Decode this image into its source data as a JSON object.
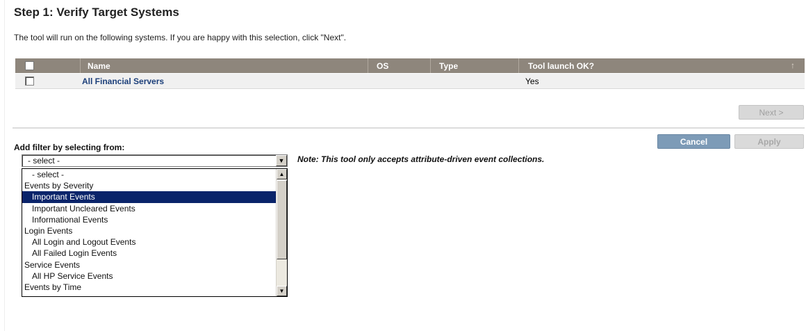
{
  "page": {
    "title": "Step 1: Verify Target Systems",
    "intro": "The tool will run on the following systems. If you are happy with this selection, click \"Next\"."
  },
  "grid": {
    "columns": [
      "Name",
      "OS",
      "Type",
      "Tool launch OK?"
    ],
    "sort_glyph": "↑",
    "rows": [
      {
        "name": "All Financial Servers",
        "os": "",
        "type": "",
        "launch_ok": "Yes"
      }
    ]
  },
  "buttons": {
    "next": "Next >",
    "cancel": "Cancel",
    "apply": "Apply"
  },
  "filter": {
    "label": "Add filter by selecting from:",
    "selected": "- select -",
    "note": "Note:  This tool only accepts attribute-driven event collections.",
    "options": [
      {
        "label": "- select -",
        "level": 1
      },
      {
        "label": "Events by Severity",
        "level": 0
      },
      {
        "label": "Important Events",
        "level": 1,
        "highlighted": true
      },
      {
        "label": "Important Uncleared Events",
        "level": 1
      },
      {
        "label": "Informational Events",
        "level": 1
      },
      {
        "label": "Login Events",
        "level": 0
      },
      {
        "label": "All Login and Logout Events",
        "level": 1
      },
      {
        "label": "All Failed Login Events",
        "level": 1
      },
      {
        "label": "Service Events",
        "level": 0
      },
      {
        "label": "All HP Service Events",
        "level": 1
      },
      {
        "label": "Events by Time",
        "level": 0
      }
    ]
  },
  "colors": {
    "header_bg": "#8e867c",
    "link": "#1c3f7a",
    "cancel_bg": "#7d9bb7",
    "selection": "#0a246a"
  }
}
